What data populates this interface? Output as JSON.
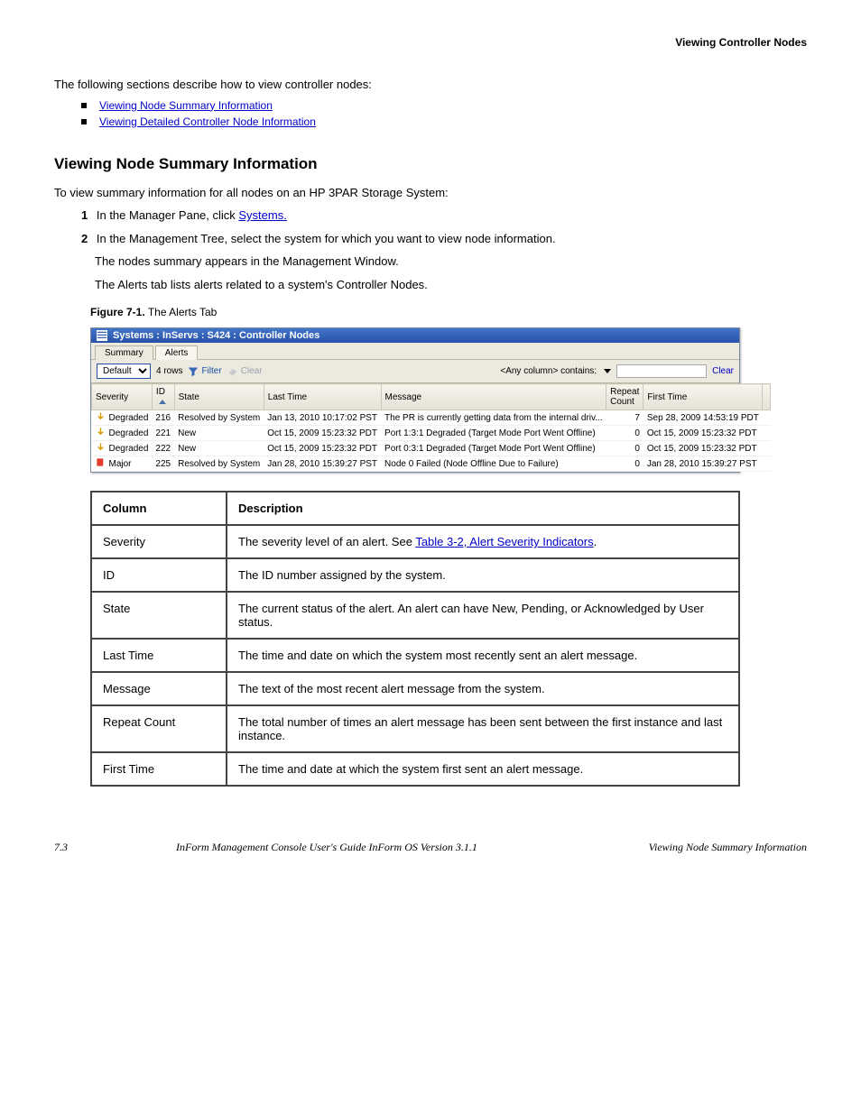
{
  "runningHead": "Viewing Controller Nodes",
  "intro": "The following sections describe how to view controller nodes:",
  "tocItems": [
    {
      "label": "Viewing Node Summary Information"
    },
    {
      "label": "Viewing Detailed Controller Node Information"
    }
  ],
  "section": {
    "title": "Viewing Node Summary Information",
    "lead": "To view summary information for all nodes on an HP 3PAR Storage System:",
    "steps": [
      "In the Manager Pane, click ",
      "In the Management Tree, select the system for which you want to view node information.",
      "The nodes summary appears in the Management Window."
    ],
    "systemsWord": "Systems.",
    "alertsPara": "The Alerts tab lists alerts related to a system's Controller Nodes."
  },
  "figure": {
    "num": "Figure 7-1.",
    "caption": "The Alerts Tab"
  },
  "shot": {
    "title": "Systems : InServs : S424 : Controller Nodes",
    "tabs": {
      "summary": "Summary",
      "alerts": "Alerts"
    },
    "selectLabel": "Default",
    "rowsText": "4 rows",
    "filterBtn": "Filter",
    "clearBtn": "Clear",
    "filterLabel": "<Any column> contains:",
    "clearLink": "Clear",
    "headers": {
      "severity": "Severity",
      "id": "ID",
      "state": "State",
      "lastTime": "Last Time",
      "message": "Message",
      "repeat": "Repeat Count",
      "firstTime": "First Time"
    },
    "rows": [
      {
        "sev": "Degraded",
        "sevType": "deg",
        "id": "216",
        "state": "Resolved by System",
        "last": "Jan 13, 2010 10:17:02 PST",
        "msg": "The PR is currently getting data from the internal driv...",
        "rep": "7",
        "first": "Sep 28, 2009 14:53:19 PDT"
      },
      {
        "sev": "Degraded",
        "sevType": "deg",
        "id": "221",
        "state": "New",
        "last": "Oct 15, 2009 15:23:32 PDT",
        "msg": "Port 1:3:1 Degraded (Target Mode Port Went Offline)",
        "rep": "0",
        "first": "Oct 15, 2009 15:23:32 PDT"
      },
      {
        "sev": "Degraded",
        "sevType": "deg",
        "id": "222",
        "state": "New",
        "last": "Oct 15, 2009 15:23:32 PDT",
        "msg": "Port 0:3:1 Degraded (Target Mode Port Went Offline)",
        "rep": "0",
        "first": "Oct 15, 2009 15:23:32 PDT"
      },
      {
        "sev": "Major",
        "sevType": "maj",
        "id": "225",
        "state": "Resolved by System",
        "last": "Jan 28, 2010 15:39:27 PST",
        "msg": "Node 0 Failed (Node Offline Due to Failure)",
        "rep": "0",
        "first": "Jan 28, 2010 15:39:27 PST"
      }
    ]
  },
  "apx": {
    "header": {
      "col": "Column",
      "desc": "Description"
    },
    "rows": [
      {
        "c": "Severity",
        "d1": "The severity level of an alert. See ",
        "link": "Table 3-2, Alert Severity Indicators",
        "d2": "."
      },
      {
        "c": "ID",
        "d": "The ID number assigned by the system."
      },
      {
        "c": "State",
        "d": "The current status of the alert. An alert can have New, Pending, or Acknowledged by User status."
      },
      {
        "c": "Last Time",
        "d": "The time and date on which the system most recently sent an alert message."
      },
      {
        "c": "Message",
        "d": "The text of the most recent alert message from the system."
      },
      {
        "c": "Repeat Count",
        "d": "The total number of times an alert message has been sent between the first instance and last instance."
      },
      {
        "c": "First Time",
        "d": "The time and date at which the system first sent an alert message."
      }
    ]
  },
  "footer": {
    "left": "InForm Management Console User's Guide InForm OS Version 3.1.1",
    "right": "Viewing Node Summary Information",
    "page": "7.3"
  }
}
